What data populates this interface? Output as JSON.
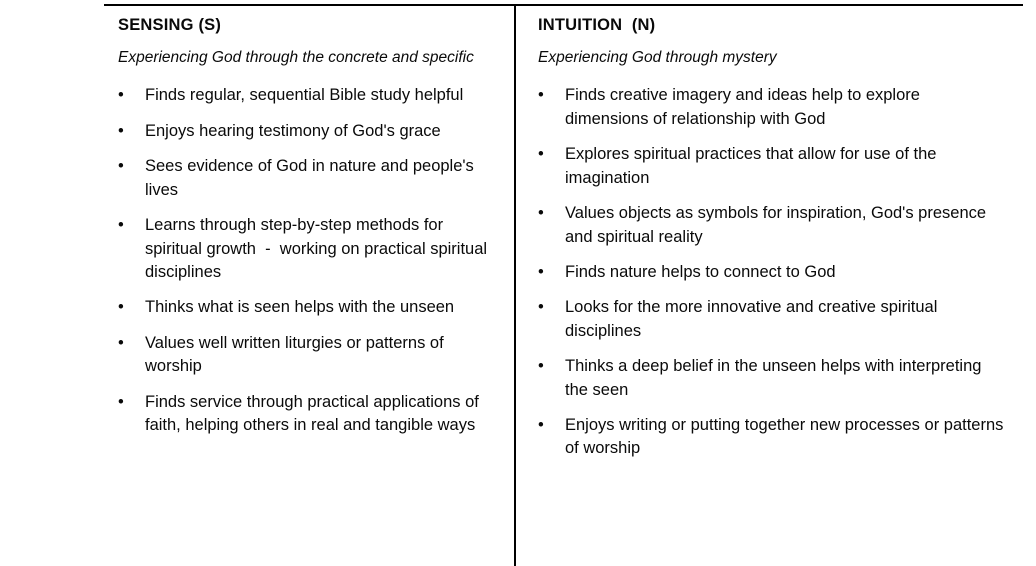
{
  "document": {
    "type": "two-column-comparison-table",
    "bullet_glyph": "•",
    "text_color": "#0a0a0a",
    "border_color": "#000000",
    "background": "#ffffff"
  },
  "columns": [
    {
      "id": "sensing",
      "title": "SENSING (S)",
      "subtitle": "Experiencing God through the concrete and specific",
      "bullets": [
        "Finds regular, sequential Bible study helpful",
        "Enjoys hearing testimony of God's grace",
        "Sees evidence of God in nature and people's lives",
        "Learns through step-by-step methods for spiritual growth  -  working on practical spiritual disciplines",
        "Thinks what is seen helps with the unseen",
        "Values well written liturgies or patterns of worship",
        "Finds service through practical applications of faith, helping others in real and tangible ways"
      ]
    },
    {
      "id": "intuition",
      "title": "INTUITION  (N)",
      "subtitle": "Experiencing God through mystery",
      "bullets": [
        "Finds creative imagery and ideas help to explore dimensions of relationship with God",
        "Explores spiritual practices that allow for use of the imagination",
        "Values objects as symbols for inspiration, God's presence and spiritual reality",
        "Finds nature helps to connect to God",
        "Looks for the more innovative and creative spiritual disciplines",
        "Thinks a deep belief in the unseen helps with interpreting the seen",
        "Enjoys writing or putting together new processes or patterns of worship"
      ]
    }
  ]
}
